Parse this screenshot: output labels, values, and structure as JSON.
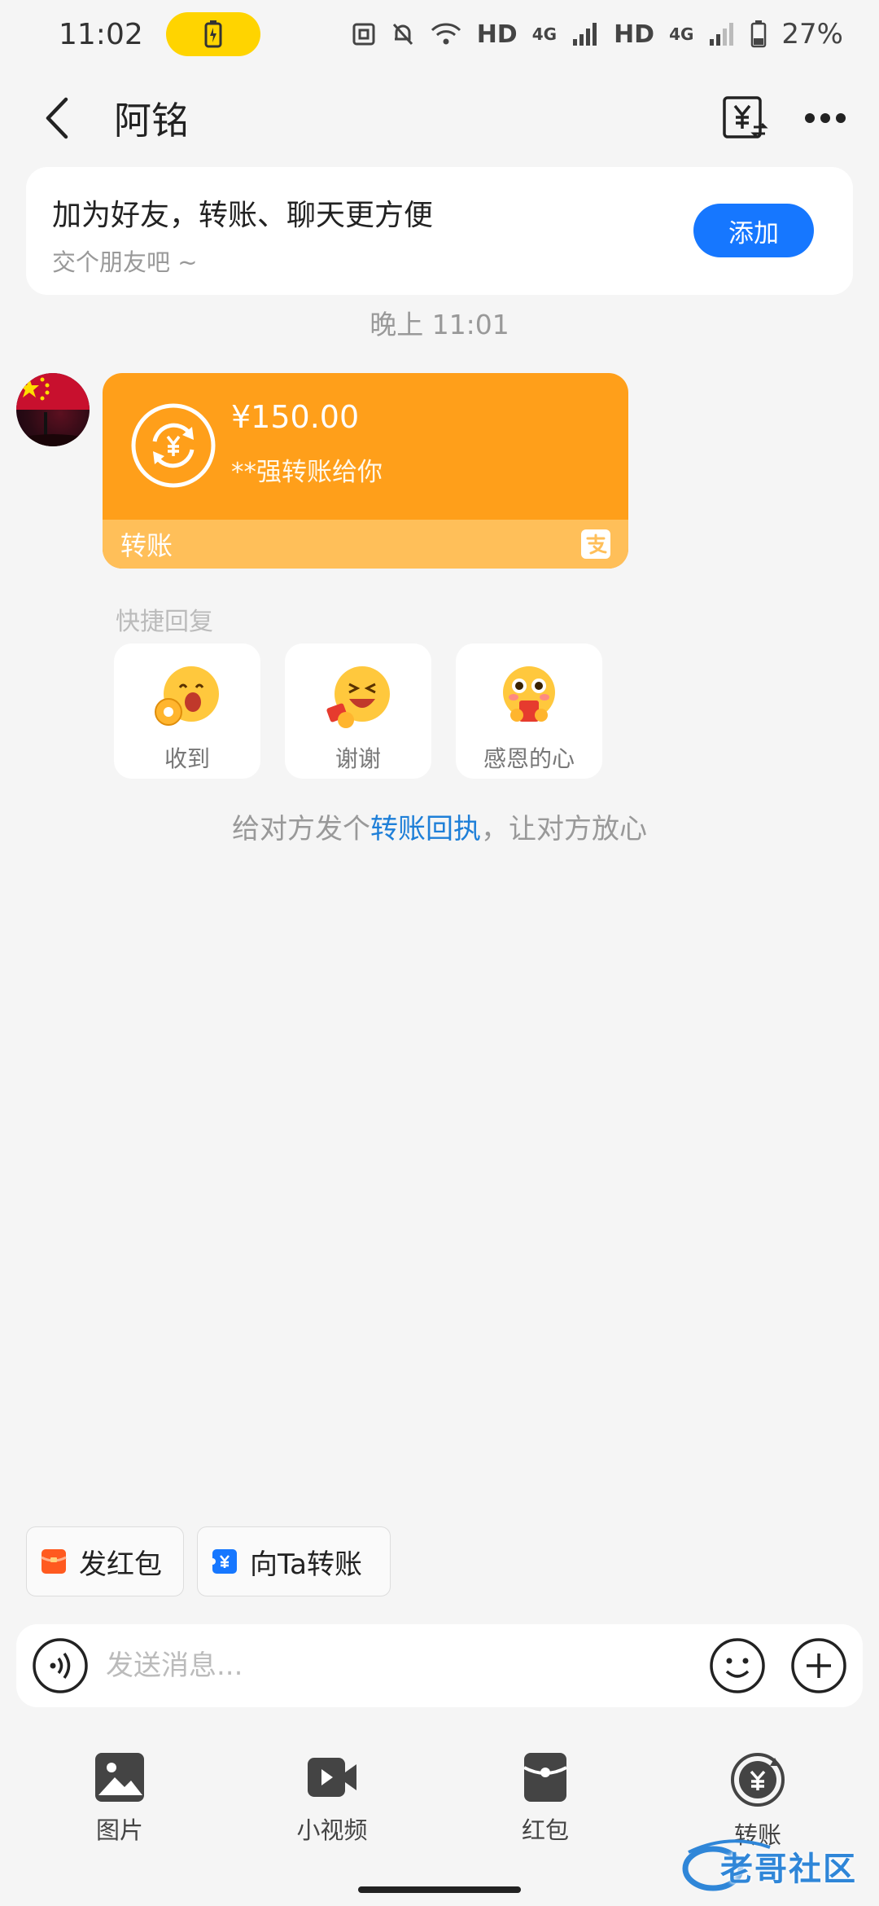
{
  "status_bar": {
    "time": "11:02",
    "network_1": "HD",
    "gen_1": "4G",
    "network_2": "HD",
    "gen_2": "4G",
    "battery_percent": "27%"
  },
  "header": {
    "title": "阿铭"
  },
  "friend_prompt": {
    "title": "加为好友，转账、聊天更方便",
    "subtitle": "交个朋友吧 ~",
    "button_label": "添加"
  },
  "chat": {
    "timestamp": "晚上 11:01",
    "transfer": {
      "amount": "¥150.00",
      "description": "**强转账给你",
      "footer_label": "转账"
    },
    "quick_reply": {
      "label": "快捷回复",
      "items": [
        {
          "label": "收到",
          "icon": "ok-hand-emoji-icon"
        },
        {
          "label": "谢谢",
          "icon": "laughing-emoji-icon"
        },
        {
          "label": "感恩的心",
          "icon": "red-packet-emoji-icon"
        }
      ]
    },
    "receipt": {
      "prefix": "给对方发个",
      "link": "转账回执",
      "suffix": "，让对方放心"
    }
  },
  "actions": {
    "red_packet_label": "发红包",
    "transfer_label": "向Ta转账"
  },
  "input": {
    "placeholder": "发送消息..."
  },
  "panel": {
    "items": [
      {
        "label": "图片",
        "icon": "image-icon"
      },
      {
        "label": "小视频",
        "icon": "video-icon"
      },
      {
        "label": "红包",
        "icon": "red-packet-icon"
      },
      {
        "label": "转账",
        "icon": "transfer-icon"
      }
    ]
  },
  "watermark": {
    "text": "老哥社区"
  },
  "colors": {
    "accent_blue": "#1677ff",
    "transfer_orange": "#ff9f1a",
    "transfer_footer": "#ffbf59",
    "link_blue": "#1e7fd8",
    "background": "#f5f5f5"
  }
}
